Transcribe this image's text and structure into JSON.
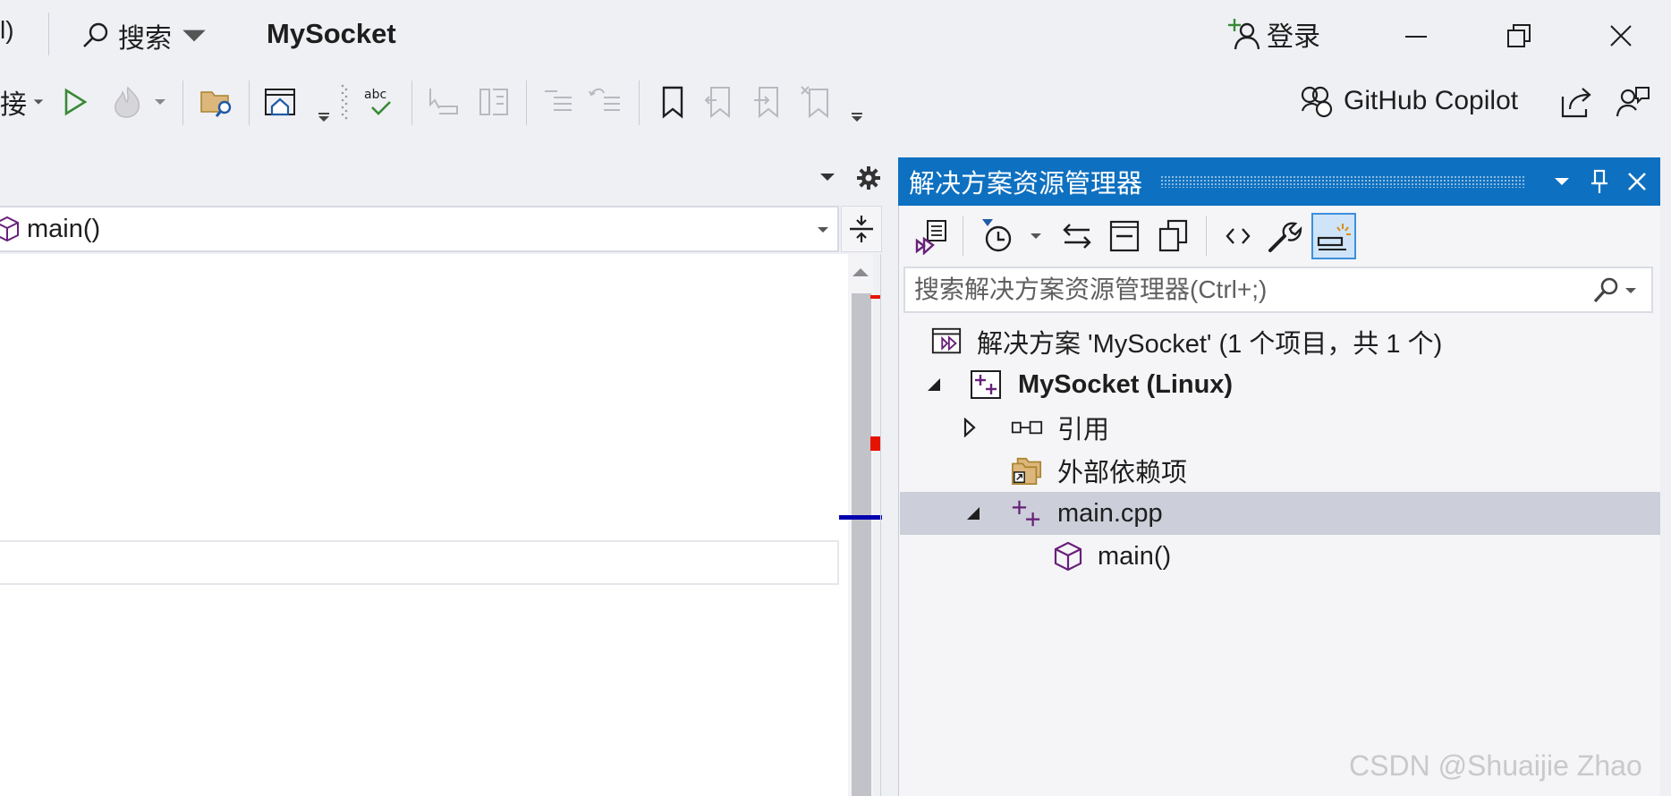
{
  "title_bar": {
    "cut_text": "l)",
    "search_label": "搜索",
    "app_title": "MySocket",
    "login_label": "登录"
  },
  "toolbar": {
    "cut_text": "接",
    "copilot_label": "GitHub Copilot"
  },
  "editor": {
    "nav_member": "main()"
  },
  "solution_explorer": {
    "title": "解决方案资源管理器",
    "search_placeholder": "搜索解决方案资源管理器(Ctrl+;)",
    "tree": [
      {
        "label": "解决方案 'MySocket' (1 个项目，共 1 个)",
        "icon": "solution-icon"
      },
      {
        "label": "MySocket (Linux)",
        "icon": "cpp-project-icon",
        "expanded": true
      },
      {
        "label": "引用",
        "icon": "references-icon",
        "expanded": false
      },
      {
        "label": "外部依赖项",
        "icon": "external-deps-folder-icon"
      },
      {
        "label": "main.cpp",
        "icon": "cpp-file-icon",
        "expanded": true,
        "selected": true
      },
      {
        "label": "main()",
        "icon": "function-cube-icon"
      }
    ]
  },
  "watermark": "CSDN @Shuaijie Zhao",
  "colors": {
    "accent": "#0e70c0",
    "selection": "#ccced9",
    "error_marker": "#e51400",
    "caret_marker": "#0000b0",
    "run_green": "#388a34",
    "cpp_purple": "#68217a"
  }
}
